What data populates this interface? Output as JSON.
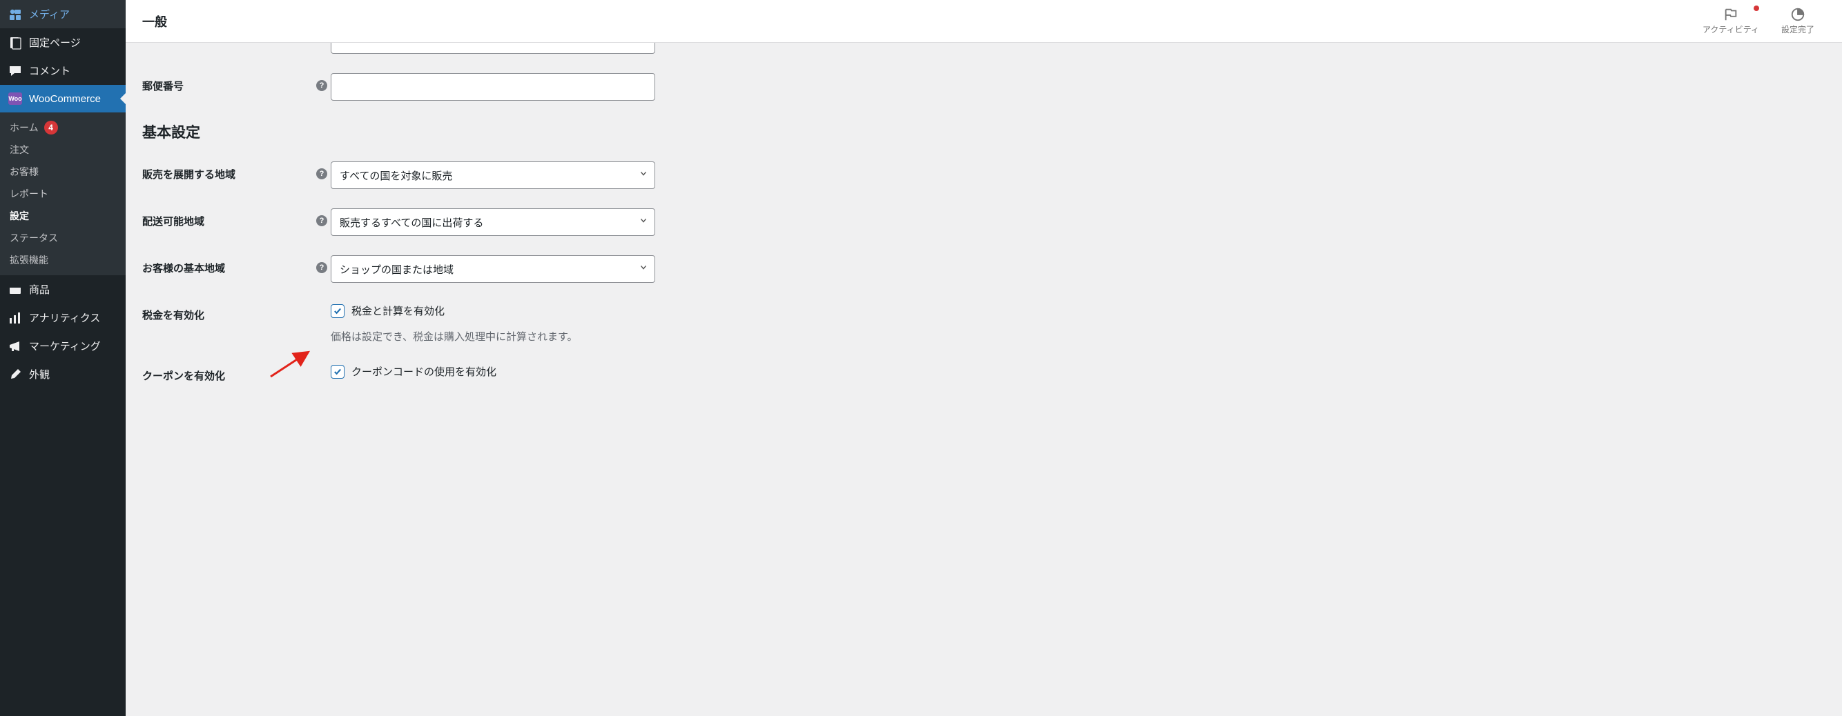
{
  "sidebar": {
    "items": [
      {
        "key": "media",
        "label": "メディア",
        "icon": "media"
      },
      {
        "key": "pages",
        "label": "固定ページ",
        "icon": "page"
      },
      {
        "key": "comments",
        "label": "コメント",
        "icon": "comment"
      },
      {
        "key": "woocommerce",
        "label": "WooCommerce",
        "icon": "woo",
        "active": true
      },
      {
        "key": "products",
        "label": "商品",
        "icon": "products"
      },
      {
        "key": "analytics",
        "label": "アナリティクス",
        "icon": "analytics"
      },
      {
        "key": "marketing",
        "label": "マーケティング",
        "icon": "marketing"
      },
      {
        "key": "appearance",
        "label": "外観",
        "icon": "appearance"
      }
    ],
    "woocommerce_sub": [
      {
        "key": "home",
        "label": "ホーム",
        "badge": "4"
      },
      {
        "key": "orders",
        "label": "注文"
      },
      {
        "key": "customers",
        "label": "お客様"
      },
      {
        "key": "reports",
        "label": "レポート"
      },
      {
        "key": "settings",
        "label": "設定",
        "current": true
      },
      {
        "key": "status",
        "label": "ステータス"
      },
      {
        "key": "extensions",
        "label": "拡張機能"
      }
    ]
  },
  "topbar": {
    "title": "一般",
    "activity_label": "アクティビティ",
    "setup_label": "設定完了"
  },
  "form": {
    "postcode_label": "郵便番号",
    "postcode_value": "",
    "section_heading": "基本設定",
    "selling_region_label": "販売を展開する地域",
    "selling_region_value": "すべての国を対象に販売",
    "shipping_region_label": "配送可能地域",
    "shipping_region_value": "販売するすべての国に出荷する",
    "customer_region_label": "お客様の基本地域",
    "customer_region_value": "ショップの国または地域",
    "enable_tax_label": "税金を有効化",
    "enable_tax_checkbox_label": "税金と計算を有効化",
    "enable_tax_desc": "価格は設定でき、税金は購入処理中に計算されます。",
    "enable_coupon_label": "クーポンを有効化",
    "enable_coupon_checkbox_label": "クーポンコードの使用を有効化"
  },
  "colors": {
    "accent": "#2271b1",
    "danger": "#d63638",
    "woo": "#7f54b3"
  }
}
